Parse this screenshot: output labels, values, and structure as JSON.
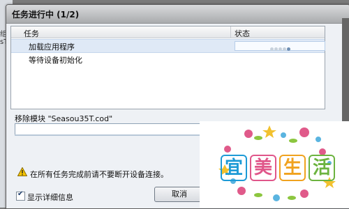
{
  "dialog": {
    "title": "任务进行中 (1/2)",
    "columns": {
      "task": "任务",
      "status": "状态"
    },
    "tasks": [
      {
        "name": "加载应用程序",
        "progress_dots_active": 1
      },
      {
        "name": "等待设备初始化"
      }
    ],
    "module_label": "移除模块 \"Seasou35T.cod\"",
    "warning": "在所有任务完成前请不要断开设备连接。",
    "show_details_label": "显示详细信息",
    "show_details_checked": true,
    "cancel_label": "取消"
  },
  "background": {
    "texts": [
      "组",
      "sT"
    ]
  },
  "logo": {
    "chars": [
      "宜",
      "美",
      "生",
      "活"
    ]
  },
  "icons": {
    "warning": "warning-triangle-icon"
  }
}
